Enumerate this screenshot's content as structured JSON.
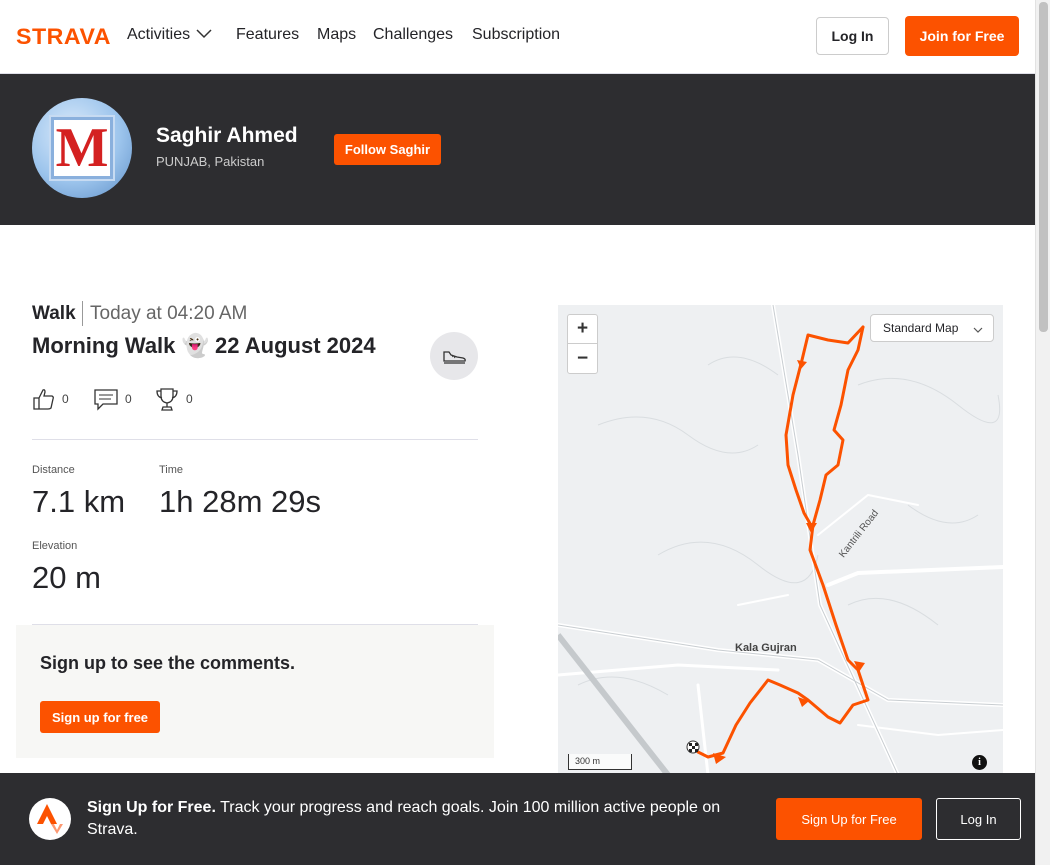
{
  "brand": {
    "name": "STRAVA",
    "accent": "#fc5200"
  },
  "nav": {
    "items": [
      {
        "label": "Activities"
      },
      {
        "label": "Features"
      },
      {
        "label": "Maps"
      },
      {
        "label": "Challenges"
      },
      {
        "label": "Subscription"
      }
    ],
    "login_label": "Log In",
    "join_label": "Join for Free"
  },
  "athlete": {
    "name": "Saghir Ahmed",
    "location": "PUNJAB, Pakistan",
    "avatar_letter": "M",
    "follow_label": "Follow Saghir"
  },
  "activity": {
    "type": "Walk",
    "time": "Today at 04:20 AM",
    "title": "Morning Walk 👻 22 August 2024",
    "kudos": "0",
    "comments": "0",
    "achievements": "0",
    "stats": [
      {
        "label": "Distance",
        "value": "7.1 km"
      },
      {
        "label": "Time",
        "value": "1h 28m 29s"
      },
      {
        "label": "Elevation",
        "value": "20 m"
      }
    ]
  },
  "comments": {
    "title": "Sign up to see the comments.",
    "button_label": "Sign up for free"
  },
  "map": {
    "style_label": "Standard Map",
    "zoom_in": "+",
    "zoom_out": "−",
    "scale_label": "300 m",
    "road_label": "Kantrili Road",
    "place_label": "Kala Gujran",
    "info_label": "i",
    "route_color": "#fc5200"
  },
  "banner": {
    "bold_text": "Sign Up for Free.",
    "text": " Track your progress and reach goals. Join 100 million active people on Strava.",
    "signup_label": "Sign Up for Free",
    "login_label": "Log In"
  }
}
